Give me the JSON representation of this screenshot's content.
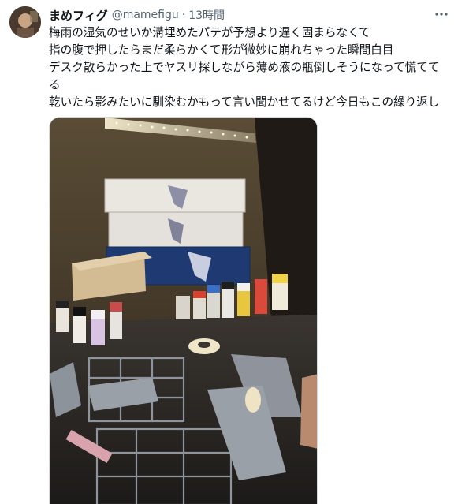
{
  "tweet": {
    "author_name": "まめフィグ",
    "author_handle": "@mamefigu",
    "separator": "·",
    "time": "13時間",
    "lines": [
      "梅雨の湿気のせいか溝埋めたパテが予想より遅く固まらなくて",
      "指の腹で押したらまだ柔らかくて形が微妙に崩れちゃった瞬間白目",
      "デスク散らかった上でヤスリ探しながら薄め液の瓶倒しそうになって慌てて",
      "る",
      "乾いたら影みたいに馴染むかもって言い聞かせてるけど今日もこの繰り返し"
    ],
    "more_icon": "more-horizontal-icon",
    "photo_icon": "model-workbench-photo"
  },
  "colors": {
    "text": "#0f1419",
    "secondary": "#536471",
    "border": "#cfd9de"
  }
}
